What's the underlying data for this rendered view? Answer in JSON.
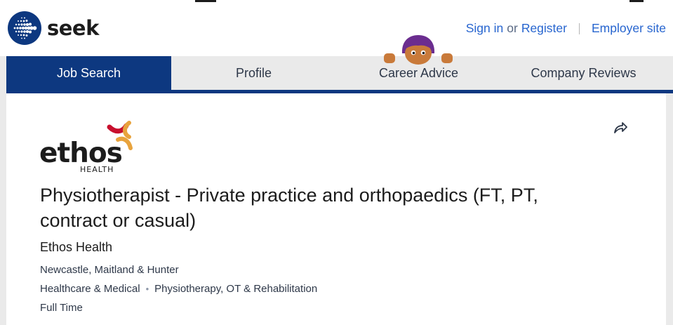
{
  "brand": {
    "name": "seek",
    "logo_color": "#0d3880"
  },
  "header": {
    "sign_in": "Sign in",
    "or": "or",
    "register": "Register",
    "employer_site": "Employer site"
  },
  "nav": {
    "tabs": [
      {
        "label": "Job Search",
        "active": true
      },
      {
        "label": "Profile",
        "active": false
      },
      {
        "label": "Career Advice",
        "active": false
      },
      {
        "label": "Company Reviews",
        "active": false
      }
    ]
  },
  "job": {
    "company_logo": {
      "name": "ethos",
      "sub": "HEALTH"
    },
    "title": "Physiotherapist - Private practice and orthopaedics (FT, PT, contract or casual)",
    "advertiser": "Ethos Health",
    "location": "Newcastle, Maitland & Hunter",
    "classification": "Healthcare & Medical",
    "sub_classification": "Physiotherapy, OT & Rehabilitation",
    "work_type": "Full Time",
    "share_icon": "share-arrow-icon"
  },
  "colors": {
    "brand_blue": "#0d3880",
    "link_blue": "#2765cf",
    "ethos_red": "#c8102e",
    "ethos_orange": "#e8a33d"
  }
}
